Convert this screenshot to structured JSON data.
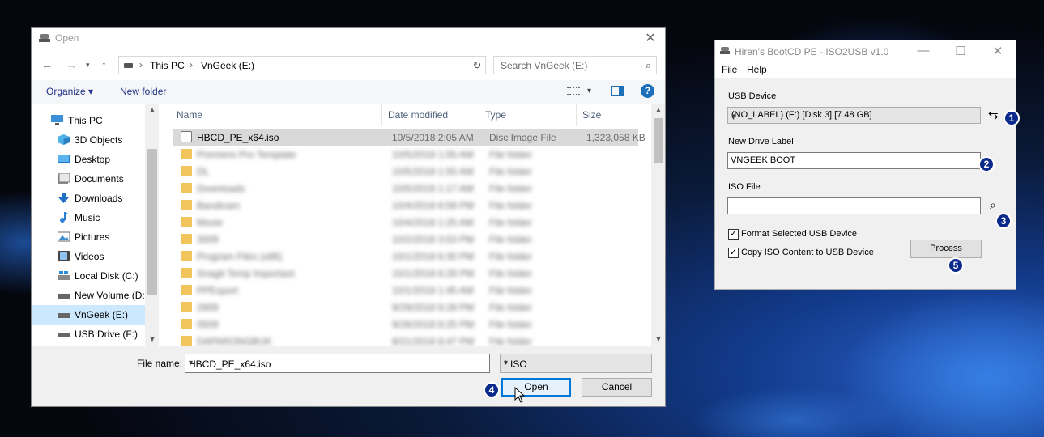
{
  "open_dialog": {
    "title": "Open",
    "address": {
      "crumbs": [
        "This PC",
        "VnGeek (E:)"
      ]
    },
    "search_placeholder": "Search VnGeek (E:)",
    "toolbar": {
      "organize": "Organize ▾",
      "new_folder": "New folder",
      "help": "?"
    },
    "nav_items": [
      {
        "label": "This PC",
        "icon": "computer-icon"
      },
      {
        "label": "3D Objects",
        "icon": "cube-icon"
      },
      {
        "label": "Desktop",
        "icon": "desktop-icon"
      },
      {
        "label": "Documents",
        "icon": "documents-icon"
      },
      {
        "label": "Downloads",
        "icon": "download-icon"
      },
      {
        "label": "Music",
        "icon": "music-icon"
      },
      {
        "label": "Pictures",
        "icon": "pictures-icon"
      },
      {
        "label": "Videos",
        "icon": "videos-icon"
      },
      {
        "label": "Local Disk (C:)",
        "icon": "disk-icon"
      },
      {
        "label": "New Volume (D:)",
        "icon": "drive-icon"
      },
      {
        "label": "VnGeek (E:)",
        "icon": "drive-icon",
        "selected": true
      },
      {
        "label": "USB Drive (F:)",
        "icon": "usb-drive-icon"
      }
    ],
    "columns": [
      "Name",
      "Date modified",
      "Type",
      "Size"
    ],
    "files": [
      {
        "name": "HBCD_PE_x64.iso",
        "date": "10/5/2018 2:05 AM",
        "type": "Disc Image File",
        "size": "1,323,058 KB",
        "selected": true,
        "kind": "iso"
      },
      {
        "name": "Premiere Pro Template",
        "date": "10/5/2018 1:55 AM",
        "type": "File folder",
        "size": "",
        "blurred": true,
        "kind": "folder"
      },
      {
        "name": "DL",
        "date": "10/5/2018 1:55 AM",
        "type": "File folder",
        "size": "",
        "blurred": true,
        "kind": "folder"
      },
      {
        "name": "Downloads",
        "date": "10/5/2018 1:17 AM",
        "type": "File folder",
        "size": "",
        "blurred": true,
        "kind": "folder"
      },
      {
        "name": "Bandicam",
        "date": "10/4/2018 6:58 PM",
        "type": "File folder",
        "size": "",
        "blurred": true,
        "kind": "folder"
      },
      {
        "name": "Movie",
        "date": "10/4/2018 1:25 AM",
        "type": "File folder",
        "size": "",
        "blurred": true,
        "kind": "folder"
      },
      {
        "name": "3009",
        "date": "10/2/2018 3:53 PM",
        "type": "File folder",
        "size": "",
        "blurred": true,
        "kind": "folder"
      },
      {
        "name": "Program Files (x86)",
        "date": "10/1/2018 6:30 PM",
        "type": "File folder",
        "size": "",
        "blurred": true,
        "kind": "folder"
      },
      {
        "name": "Snagit Temp Important",
        "date": "10/1/2018 6:28 PM",
        "type": "File folder",
        "size": "",
        "blurred": true,
        "kind": "folder"
      },
      {
        "name": "PPExport",
        "date": "10/1/2018 1:45 AM",
        "type": "File folder",
        "size": "",
        "blurred": true,
        "kind": "folder"
      },
      {
        "name": "2909",
        "date": "9/29/2018 6:28 PM",
        "type": "File folder",
        "size": "",
        "blurred": true,
        "kind": "folder"
      },
      {
        "name": "0509",
        "date": "9/26/2018 8:25 PM",
        "type": "File folder",
        "size": "",
        "blurred": true,
        "kind": "folder"
      },
      {
        "name": "DAPARONGBUK",
        "date": "8/21/2018 8:47 PM",
        "type": "File folder",
        "size": "",
        "blurred": true,
        "kind": "folder"
      }
    ],
    "file_name_label": "File name:",
    "file_name_value": "HBCD_PE_x64.iso",
    "filter_value": "*.ISO",
    "open_button": "Open",
    "cancel_button": "Cancel",
    "step_badge": "4"
  },
  "iso2usb": {
    "title": "Hiren's BootCD PE - ISO2USB v1.0",
    "menu": [
      "File",
      "Help"
    ],
    "usb_device_label": "USB Device",
    "usb_device_value": "(NO_LABEL) (F:) [Disk 3] [7.48 GB]",
    "new_drive_label": "New Drive Label",
    "new_drive_value": "VNGEEK BOOT",
    "iso_file_label": "ISO File",
    "iso_file_value": "",
    "format_checkbox": "Format Selected USB Device",
    "copy_checkbox": "Copy ISO Content to USB Device",
    "process_button": "Process",
    "badges": [
      "1",
      "2",
      "3",
      "5"
    ]
  }
}
